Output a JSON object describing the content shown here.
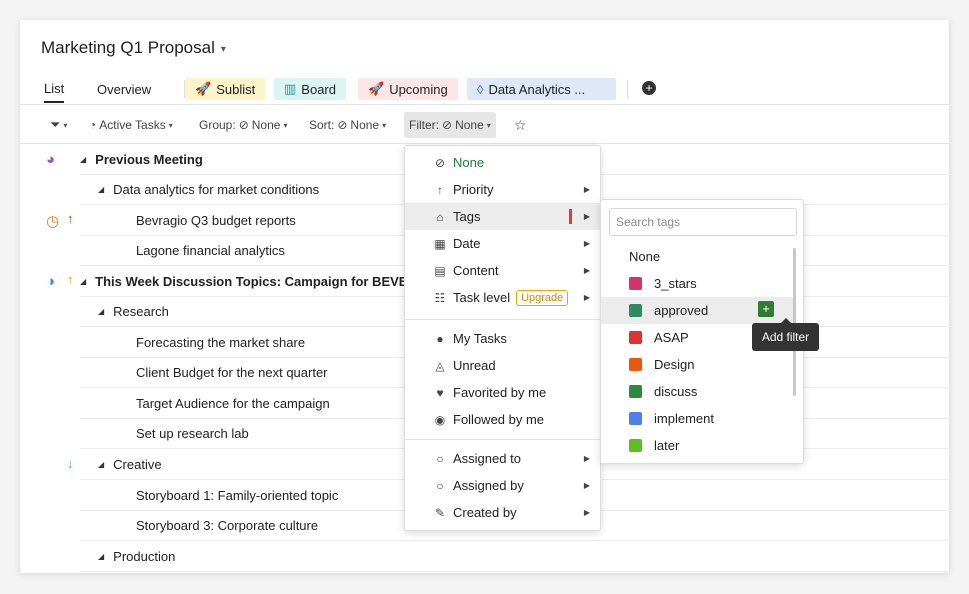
{
  "window": {
    "title": "Marketing Q1 Proposal"
  },
  "tabs": [
    {
      "label": "List",
      "icon": ""
    },
    {
      "label": "Overview",
      "icon": ""
    },
    {
      "label": "Sublist",
      "icon": "rocket-icon",
      "color": "#fdf5c9"
    },
    {
      "label": "Board",
      "icon": "board-icon",
      "color": "#dcf5f3"
    },
    {
      "label": "Upcoming",
      "icon": "rocket-icon",
      "color": "#fde6e6"
    },
    {
      "label": "Data Analytics ...",
      "icon": "drop-icon",
      "color": "#dfe8f8"
    }
  ],
  "toolbar": {
    "active_tasks": "Active Tasks",
    "group": "Group:",
    "group_value": "None",
    "sort": "Sort:",
    "sort_value": "None",
    "filter": "Filter:",
    "filter_value": "None"
  },
  "rows": [
    {
      "label": "Previous Meeting"
    },
    {
      "label": "Data analytics for market conditions"
    },
    {
      "label": "Bevragio Q3 budget reports"
    },
    {
      "label": "Lagone financial analytics"
    },
    {
      "label": "This Week Discussion Topics: Campaign for BEVEI"
    },
    {
      "label": "Research"
    },
    {
      "label": "Forecasting the market share"
    },
    {
      "label": "Client Budget for the next quarter"
    },
    {
      "label": "Target Audience for the campaign"
    },
    {
      "label": "Set up research lab"
    },
    {
      "label": "Creative"
    },
    {
      "label": "Storyboard 1: Family-oriented topic"
    },
    {
      "label": "Storyboard 3: Corporate culture"
    },
    {
      "label": "Production"
    }
  ],
  "filter_menu": {
    "none": "None",
    "priority": "Priority",
    "tags": "Tags",
    "date": "Date",
    "content": "Content",
    "task_level": "Task level",
    "upgrade": "Upgrade",
    "my_tasks": "My Tasks",
    "unread": "Unread",
    "favorited": "Favorited by me",
    "followed": "Followed by me",
    "assigned_to": "Assigned to",
    "assigned_by": "Assigned by",
    "created_by": "Created by"
  },
  "tags_menu": {
    "search_placeholder": "Search tags",
    "none": "None",
    "items": [
      {
        "label": "3_stars",
        "color": "#d6336c"
      },
      {
        "label": "approved",
        "color": "#2f8a5e"
      },
      {
        "label": "ASAP",
        "color": "#e03131"
      },
      {
        "label": "Design",
        "color": "#e8590c"
      },
      {
        "label": "discuss",
        "color": "#2b8a3e"
      },
      {
        "label": "implement",
        "color": "#4c7fe8"
      },
      {
        "label": "later",
        "color": "#5fbf1a"
      }
    ]
  },
  "tooltip": {
    "text": "Add filter"
  }
}
